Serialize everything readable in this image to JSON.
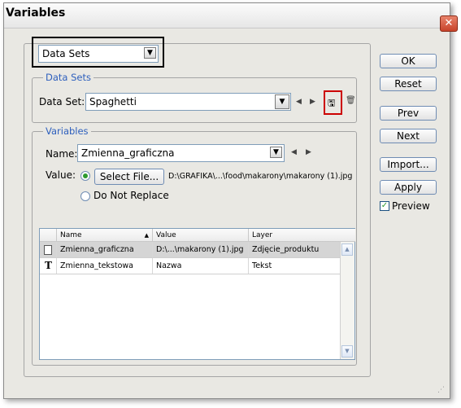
{
  "window": {
    "title": "Variables",
    "close_glyph": "✕"
  },
  "mode_select": {
    "value": "Data Sets"
  },
  "data_sets": {
    "legend": "Data Sets",
    "label": "Data Set:",
    "value": "Spaghetti"
  },
  "variables": {
    "legend": "Variables",
    "name_label": "Name:",
    "name_value": "Zmienna_graficzna",
    "value_label": "Value:",
    "select_file_label": "Select File...",
    "file_path": "D:\\GRAFIKA\\...\\food\\makarony\\makarony (1).jpg",
    "do_not_replace_label": "Do Not Replace"
  },
  "table": {
    "headers": {
      "name": "Name",
      "value": "Value",
      "layer": "Layer"
    },
    "sort_glyph": "▲",
    "rows": [
      {
        "icon": "image-variable-icon",
        "name": "Zmienna_graficzna",
        "value": "D:\\...\\makarony (1).jpg",
        "layer": "Zdjęcie_produktu"
      },
      {
        "icon": "text-variable-icon",
        "type_glyph": "T",
        "name": "Zmienna_tekstowa",
        "value": "Nazwa",
        "layer": "Tekst"
      }
    ]
  },
  "buttons": {
    "ok": "OK",
    "reset": "Reset",
    "prev": "Prev",
    "next": "Next",
    "import": "Import...",
    "apply": "Apply"
  },
  "preview": {
    "label": "Preview",
    "checked": true
  },
  "colors": {
    "highlight_box": "#000000",
    "save_highlight": "#cc0000",
    "legend_text": "#2d5fbd",
    "selected_row": "#d5d5d5"
  }
}
